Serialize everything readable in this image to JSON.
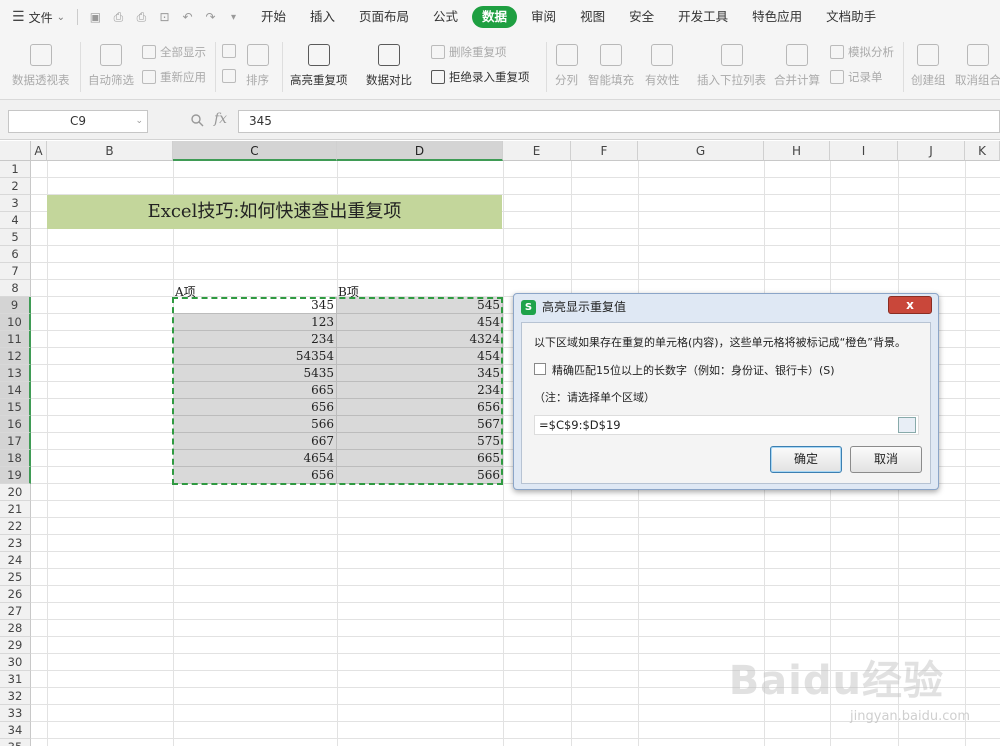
{
  "menubar": {
    "file_label": "文件",
    "tabs": [
      "开始",
      "插入",
      "页面布局",
      "公式",
      "数据",
      "审阅",
      "视图",
      "安全",
      "开发工具",
      "特色应用",
      "文档助手"
    ],
    "active_tab": "数据"
  },
  "ribbon": {
    "pivot": "数据透视表",
    "autofilter": "自动筛选",
    "show_all": "全部显示",
    "reapply": "重新应用",
    "sort": "排序",
    "highlight_dup": "高亮重复项",
    "compare": "数据对比",
    "remove_dup": "删除重复项",
    "reject_dup": "拒绝录入重复项",
    "split": "分列",
    "smart_fill": "智能填充",
    "validity": "有效性",
    "insert_dropdown": "插入下拉列表",
    "consolidate": "合并计算",
    "simulation": "模拟分析",
    "record_form": "记录单",
    "create_group": "创建组",
    "ungroup": "取消组合"
  },
  "formula_bar": {
    "cell_ref": "C9",
    "fx": "fx",
    "content": "345"
  },
  "columns": [
    "A",
    "B",
    "C",
    "D",
    "E",
    "F",
    "G",
    "H",
    "I",
    "J",
    "K"
  ],
  "rows": [
    "1",
    "2",
    "3",
    "4",
    "5",
    "6",
    "7",
    "8",
    "9",
    "10",
    "11",
    "12",
    "13",
    "14",
    "15",
    "16",
    "17",
    "18",
    "19",
    "20",
    "21",
    "22",
    "23",
    "24",
    "25",
    "26",
    "27",
    "28",
    "29",
    "30",
    "31",
    "32",
    "33",
    "34",
    "35"
  ],
  "sheet": {
    "title": "Excel技巧:如何快速查出重复项",
    "header_a": "A项",
    "header_b": "B项",
    "col_c": [
      "345",
      "123",
      "234",
      "54354",
      "5435",
      "665",
      "656",
      "566",
      "667",
      "4654",
      "656"
    ],
    "col_d": [
      "545",
      "454",
      "4324",
      "454",
      "345",
      "234",
      "656",
      "567",
      "575",
      "665",
      "566"
    ]
  },
  "dialog": {
    "title": "高亮显示重复值",
    "close": "x",
    "description": "以下区域如果存在重复的单元格(内容)，这些单元格将被标记成“橙色”背景。",
    "checkbox_label": "精确匹配15位以上的长数字（例如：身份证、银行卡）(S)",
    "note": "（注：请选择单个区域）",
    "range_value": "=$C$9:$D$19",
    "ok": "确定",
    "cancel": "取消"
  },
  "watermark": {
    "text": "Baidu经验",
    "url": "jingyan.baidu.com"
  }
}
